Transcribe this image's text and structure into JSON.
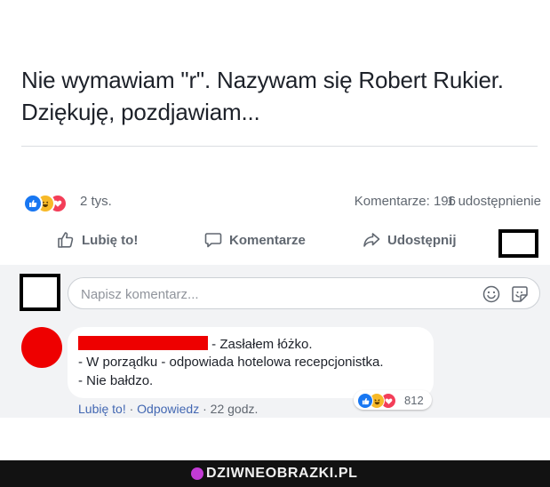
{
  "post": {
    "line1": "Nie wymawiam \"r\". Nazywam się Robert Rukier.",
    "line2": "Dziękuję, pozdjawiam..."
  },
  "stats": {
    "reaction_count": "2 tys.",
    "comments": "Komentarze: 196",
    "shares": "1 udostępnienie"
  },
  "actions": {
    "like": "Lubię to!",
    "comment": "Komentarze",
    "share": "Udostępnij"
  },
  "comment_input": {
    "placeholder": "Napisz komentarz..."
  },
  "comment": {
    "line1": " - Zasłałem łóżko.",
    "line2": "- W porządku - odpowiada hotelowa recepcjonistka.",
    "line3": "- Nie bałdzo.",
    "reaction_count": "812",
    "like_label": "Lubię to!",
    "reply_label": "Odpowiedz",
    "time": "22 godz.",
    "separator": " · "
  },
  "watermark": {
    "text": "DZIWNEOBRAZKI.PL"
  },
  "colors": {
    "like_blue": "#1877f2",
    "haha_yellow": "#f7b928",
    "love_red": "#f33e58",
    "redaction": "#ee0000"
  },
  "icons": [
    "like-reaction-icon",
    "haha-reaction-icon",
    "love-reaction-icon",
    "thumbs-up-icon",
    "comment-bubble-icon",
    "share-arrow-icon",
    "emoji-icon",
    "sticker-icon"
  ]
}
